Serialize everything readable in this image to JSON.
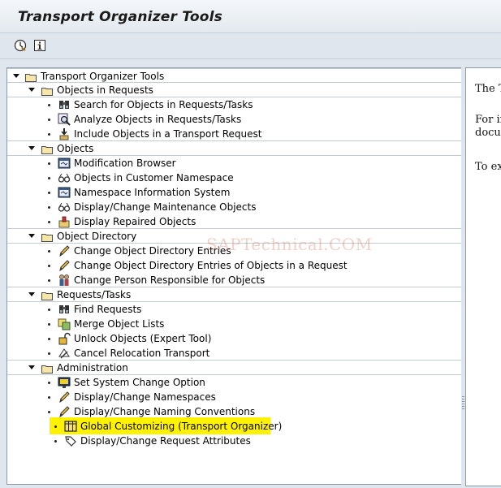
{
  "window": {
    "title": "Transport Organizer Tools"
  },
  "toolbar": {
    "buttons": [
      {
        "name": "execute",
        "icon": "execute-icon",
        "tooltip": ""
      },
      {
        "name": "information",
        "icon": "info-icon",
        "tooltip": ""
      }
    ]
  },
  "tree": {
    "root": {
      "label": "Transport Organizer Tools",
      "expanded": true
    },
    "sections": [
      {
        "label": "Objects in Requests",
        "items": [
          {
            "label": "Search for Objects in Requests/Tasks",
            "icon": "binoculars-icon"
          },
          {
            "label": "Analyze Objects in Requests/Tasks",
            "icon": "magnifier-report-icon"
          },
          {
            "label": "Include Objects in a Transport Request",
            "icon": "include-object-icon"
          }
        ]
      },
      {
        "label": "Objects",
        "items": [
          {
            "label": "Modification Browser",
            "icon": "browser-window-icon"
          },
          {
            "label": "Objects in Customer Namespace",
            "icon": "glasses-icon"
          },
          {
            "label": "Namespace Information System",
            "icon": "browser-window-icon"
          },
          {
            "label": "Display/Change Maintenance Objects",
            "icon": "glasses-icon"
          },
          {
            "label": "Display Repaired Objects",
            "icon": "repaired-object-icon"
          }
        ]
      },
      {
        "label": "Object Directory",
        "items": [
          {
            "label": "Change Object Directory Entries",
            "icon": "pencil-icon"
          },
          {
            "label": "Change Object Directory Entries of Objects in a Request",
            "icon": "pencil-icon"
          },
          {
            "label": "Change Person Responsible for Objects",
            "icon": "persons-icon"
          }
        ]
      },
      {
        "label": "Requests/Tasks",
        "items": [
          {
            "label": "Find Requests",
            "icon": "binoculars-icon"
          },
          {
            "label": "Merge Object Lists",
            "icon": "merge-lists-icon"
          },
          {
            "label": "Unlock Objects (Expert Tool)",
            "icon": "unlock-icon"
          },
          {
            "label": "Cancel Relocation Transport",
            "icon": "cancel-relocation-icon"
          }
        ]
      },
      {
        "label": "Administration",
        "items": [
          {
            "label": "Set System Change Option",
            "icon": "monitor-icon"
          },
          {
            "label": "Display/Change Namespaces",
            "icon": "pencil-icon"
          },
          {
            "label": "Display/Change Naming Conventions",
            "icon": "pencil-icon"
          },
          {
            "label": "Global Customizing (Transport Organizer)",
            "icon": "table-grid-icon",
            "highlighted": true,
            "highlight_color": "#fff200"
          },
          {
            "label": "Display/Change Request Attributes",
            "icon": "tag-icon"
          }
        ]
      }
    ]
  },
  "doc_panel": {
    "lines": [
      "The T",
      "For in",
      "docum",
      "To ex"
    ]
  },
  "watermark": {
    "text": "SAPTechnical.COM"
  },
  "colors": {
    "panel_background": "#dfe6ed",
    "border": "#8a9aaa",
    "highlight": "#fff200"
  }
}
